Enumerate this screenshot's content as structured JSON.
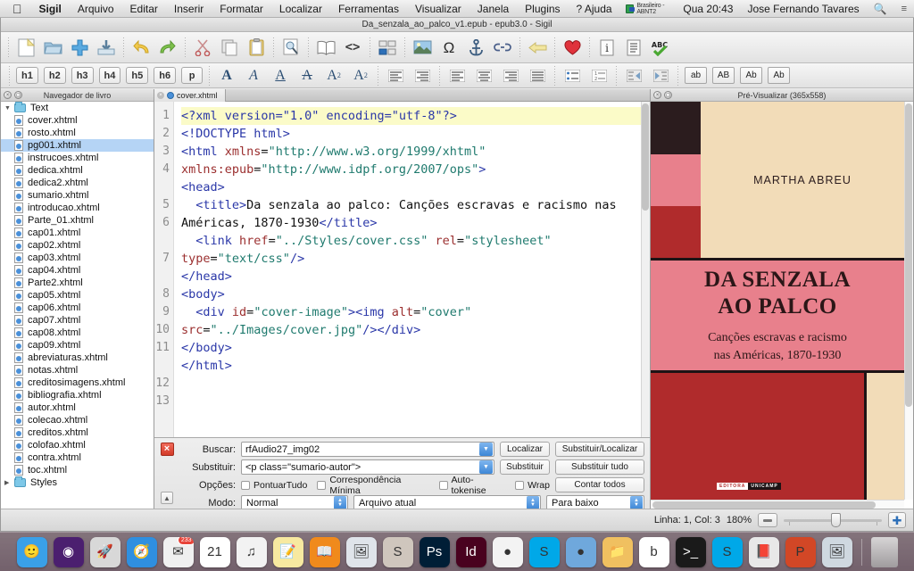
{
  "menubar": {
    "apple_icon": "apple-icon",
    "items": [
      {
        "label": "Sigil",
        "bold": true
      },
      {
        "label": "Arquivo"
      },
      {
        "label": "Editar"
      },
      {
        "label": "Inserir"
      },
      {
        "label": "Formatar"
      },
      {
        "label": "Localizar"
      },
      {
        "label": "Ferramentas"
      },
      {
        "label": "Visualizar"
      },
      {
        "label": "Janela"
      },
      {
        "label": "Plugins"
      },
      {
        "label": "? Ajuda"
      }
    ],
    "input_source": "Brasileiro - ABNT2",
    "clock": "Qua 20:43",
    "user": "Jose Fernando Tavares",
    "search_icon": "search-icon",
    "notification_icon": "notification-center-icon"
  },
  "window": {
    "title": "Da_senzala_ao_palco_v1.epub - epub3.0 - Sigil"
  },
  "toolbar_main": [
    {
      "name": "new-file-button",
      "glyph": "❐"
    },
    {
      "name": "open-folder-button",
      "glyph": "📁"
    },
    {
      "name": "add-file-button",
      "glyph": "✚"
    },
    {
      "name": "save-button",
      "glyph": "💾"
    },
    {
      "name": "undo-button",
      "glyph": "↶"
    },
    {
      "name": "redo-button",
      "glyph": "↷"
    },
    {
      "name": "cut-button",
      "glyph": "✂"
    },
    {
      "name": "copy-button",
      "glyph": "❐"
    },
    {
      "name": "paste-button",
      "glyph": "📋"
    },
    {
      "name": "preview-button",
      "glyph": "🔍"
    },
    {
      "name": "book-view-button",
      "glyph": "📖"
    },
    {
      "name": "code-view-button",
      "glyph": "<>"
    },
    {
      "name": "split-view-button",
      "glyph": "☷"
    },
    {
      "name": "insert-image-button",
      "glyph": "🏞"
    },
    {
      "name": "insert-special-character-button",
      "glyph": "Ω"
    },
    {
      "name": "insert-anchor-button",
      "glyph": "⚓"
    },
    {
      "name": "insert-link-button",
      "glyph": "🔗"
    },
    {
      "name": "back-button",
      "glyph": "←"
    },
    {
      "name": "add-to-favorites-button",
      "glyph": "♥"
    },
    {
      "name": "metadata-editor-button",
      "glyph": "ℹ"
    },
    {
      "name": "toc-editor-button",
      "glyph": "☰"
    },
    {
      "name": "spellcheck-button",
      "glyph": "ABC✔"
    }
  ],
  "toolbar_format": {
    "heading_buttons": [
      "h1",
      "h2",
      "h3",
      "h4",
      "h5",
      "h6",
      "p"
    ],
    "style_buttons": [
      {
        "name": "bold-button",
        "glyph": "A"
      },
      {
        "name": "italic-button",
        "glyph": "A"
      },
      {
        "name": "underline-button",
        "glyph": "A"
      },
      {
        "name": "strikethrough-button",
        "glyph": "A"
      },
      {
        "name": "subscript-button",
        "glyph": "A₂"
      },
      {
        "name": "superscript-button",
        "glyph": "A²"
      }
    ],
    "align_buttons": [
      {
        "name": "align-left-button",
        "glyph": "≡"
      },
      {
        "name": "align-center-button",
        "glyph": "≡"
      },
      {
        "name": "align-right-button",
        "glyph": "≡"
      },
      {
        "name": "align-justify-button",
        "glyph": "≡"
      },
      {
        "name": "bullet-list-button",
        "glyph": "☰"
      },
      {
        "name": "numbered-list-button",
        "glyph": "☰"
      },
      {
        "name": "decrease-indent-button",
        "glyph": "⬅"
      },
      {
        "name": "increase-indent-button",
        "glyph": "➡"
      }
    ],
    "case_buttons": [
      "ab",
      "AB",
      "Ab",
      "Ab"
    ]
  },
  "browser": {
    "title": "Navegador de livro",
    "folders": [
      {
        "label": "Text",
        "expanded": true
      },
      {
        "label": "Styles",
        "expanded": false
      }
    ],
    "files": [
      "cover.xhtml",
      "rosto.xhtml",
      "pg001.xhtml",
      "instrucoes.xhtml",
      "dedica.xhtml",
      "dedica2.xhtml",
      "sumario.xhtml",
      "introducao.xhtml",
      "Parte_01.xhtml",
      "cap01.xhtml",
      "cap02.xhtml",
      "cap03.xhtml",
      "cap04.xhtml",
      "Parte2.xhtml",
      "cap05.xhtml",
      "cap06.xhtml",
      "cap07.xhtml",
      "cap08.xhtml",
      "cap09.xhtml",
      "abreviaturas.xhtml",
      "notas.xhtml",
      "creditosimagens.xhtml",
      "bibliografia.xhtml",
      "autor.xhtml",
      "colecao.xhtml",
      "creditos.xhtml",
      "colofao.xhtml",
      "contra.xhtml",
      "toc.xhtml"
    ],
    "selected_file": "pg001.xhtml"
  },
  "editor": {
    "tab_label": "cover.xhtml",
    "lines": [
      {
        "num": "1",
        "highlight": true,
        "wrapped": false,
        "parts": [
          {
            "t": "pi",
            "v": "<?xml version=\"1.0\" encoding=\"utf-8\"?>"
          }
        ]
      },
      {
        "num": "2",
        "highlight": false,
        "wrapped": false,
        "parts": [
          {
            "t": "tag",
            "v": "<!DOCTYPE html>"
          }
        ]
      },
      {
        "num": "3",
        "highlight": false,
        "wrapped": false,
        "parts": [
          {
            "t": "txt",
            "v": ""
          }
        ]
      },
      {
        "num": "4",
        "highlight": false,
        "wrapped": true,
        "parts": [
          {
            "t": "tag",
            "v": "<html "
          },
          {
            "t": "attr",
            "v": "xmlns"
          },
          {
            "t": "txt",
            "v": "="
          },
          {
            "t": "val",
            "v": "\"http://www.w3.org/1999/xhtml\""
          },
          {
            "t": "txt",
            "v": " "
          },
          {
            "t": "attr",
            "v": "xmlns:epub"
          },
          {
            "t": "txt",
            "v": "="
          },
          {
            "t": "val",
            "v": "\"http://www.idpf.org/2007/ops\""
          },
          {
            "t": "tag",
            "v": ">"
          }
        ]
      },
      {
        "num": "5",
        "highlight": false,
        "wrapped": false,
        "parts": [
          {
            "t": "tag",
            "v": "<head>"
          }
        ]
      },
      {
        "num": "6",
        "highlight": false,
        "wrapped": true,
        "parts": [
          {
            "t": "txt",
            "v": "  "
          },
          {
            "t": "tag",
            "v": "<title>"
          },
          {
            "t": "txt",
            "v": "Da senzala ao palco: Canções escravas e racismo nas Américas, 1870-1930"
          },
          {
            "t": "tag",
            "v": "</title>"
          }
        ]
      },
      {
        "num": "7",
        "highlight": false,
        "wrapped": true,
        "parts": [
          {
            "t": "txt",
            "v": "  "
          },
          {
            "t": "tag",
            "v": "<link "
          },
          {
            "t": "attr",
            "v": "href"
          },
          {
            "t": "txt",
            "v": "="
          },
          {
            "t": "val",
            "v": "\"../Styles/cover.css\""
          },
          {
            "t": "txt",
            "v": " "
          },
          {
            "t": "attr",
            "v": "rel"
          },
          {
            "t": "txt",
            "v": "="
          },
          {
            "t": "val",
            "v": "\"stylesheet\""
          },
          {
            "t": "txt",
            "v": " "
          },
          {
            "t": "attr",
            "v": "type"
          },
          {
            "t": "txt",
            "v": "="
          },
          {
            "t": "val",
            "v": "\"text/css\""
          },
          {
            "t": "tag",
            "v": "/>"
          }
        ]
      },
      {
        "num": "8",
        "highlight": false,
        "wrapped": false,
        "parts": [
          {
            "t": "tag",
            "v": "</head>"
          }
        ]
      },
      {
        "num": "9",
        "highlight": false,
        "wrapped": false,
        "parts": [
          {
            "t": "txt",
            "v": ""
          }
        ]
      },
      {
        "num": "10",
        "highlight": false,
        "wrapped": false,
        "parts": [
          {
            "t": "tag",
            "v": "<body>"
          }
        ]
      },
      {
        "num": "11",
        "highlight": false,
        "wrapped": true,
        "parts": [
          {
            "t": "txt",
            "v": "  "
          },
          {
            "t": "tag",
            "v": "<div "
          },
          {
            "t": "attr",
            "v": "id"
          },
          {
            "t": "txt",
            "v": "="
          },
          {
            "t": "val",
            "v": "\"cover-image\""
          },
          {
            "t": "tag",
            "v": ">"
          },
          {
            "t": "tag",
            "v": "<img "
          },
          {
            "t": "attr",
            "v": "alt"
          },
          {
            "t": "txt",
            "v": "="
          },
          {
            "t": "val",
            "v": "\"cover\""
          },
          {
            "t": "txt",
            "v": " "
          },
          {
            "t": "attr",
            "v": "src"
          },
          {
            "t": "txt",
            "v": "="
          },
          {
            "t": "val",
            "v": "\"../Images/cover.jpg\""
          },
          {
            "t": "tag",
            "v": "/>"
          },
          {
            "t": "tag",
            "v": "</div>"
          }
        ]
      },
      {
        "num": "12",
        "highlight": false,
        "wrapped": false,
        "parts": [
          {
            "t": "tag",
            "v": "</body>"
          }
        ]
      },
      {
        "num": "13",
        "highlight": false,
        "wrapped": false,
        "parts": [
          {
            "t": "tag",
            "v": "</html>"
          }
        ]
      }
    ]
  },
  "find_replace": {
    "find_label": "Buscar:",
    "find_value": "rfAudio27_img02",
    "replace_label": "Substituir:",
    "replace_value": "<p class=\"sumario-autor\">",
    "options_label": "Opções:",
    "options": [
      "PontuarTudo",
      "Correspondência Mínima",
      "Auto-tokenise",
      "Wrap"
    ],
    "mode_label": "Modo:",
    "mode_value": "Normal",
    "scope_value": "Arquivo atual",
    "direction_value": "Para baixo",
    "buttons": {
      "find": "Localizar",
      "replace_find": "Substituir/Localizar",
      "replace": "Substituir",
      "replace_all": "Substituir tudo",
      "count_all": "Contar todos"
    }
  },
  "preview": {
    "title": "Pré-Visualizar (365x558)",
    "cover": {
      "author": "MARTHA ABREU",
      "title_line1": "DA SENZALA",
      "title_line2": "AO PALCO",
      "subtitle_line1": "Canções escravas e racismo",
      "subtitle_line2": "nas Américas, 1870-1930",
      "publisher_white": "EDITORA",
      "publisher_black": "UNICAMP",
      "colors": {
        "cream": "#f2dcb8",
        "pink": "#e8808c",
        "red": "#b02b2c",
        "dark": "#2b1c1e"
      }
    }
  },
  "statusbar": {
    "position": "Linha: 1, Col: 3",
    "zoom": "180%",
    "reset_zoom_icon": "minus-icon",
    "zoom_in_icon": "plus-icon"
  },
  "dock": {
    "items": [
      {
        "name": "finder",
        "glyph": "🙂",
        "bg": "#3aa0e8",
        "running": true
      },
      {
        "name": "siri",
        "glyph": "◉",
        "bg": "#4b1f6f",
        "running": false
      },
      {
        "name": "launchpad",
        "glyph": "🚀",
        "bg": "#d8d8d8",
        "running": false
      },
      {
        "name": "safari",
        "glyph": "🧭",
        "bg": "#2f8fe0",
        "running": false
      },
      {
        "name": "mail",
        "glyph": "✉",
        "bg": "#f0f0f0",
        "running": true,
        "badge": "233"
      },
      {
        "name": "calendar",
        "glyph": "21",
        "bg": "#ffffff",
        "running": false
      },
      {
        "name": "itunes",
        "glyph": "♫",
        "bg": "#f2f2f2",
        "running": false
      },
      {
        "name": "notes",
        "glyph": "📝",
        "bg": "#f7e9a0",
        "running": false
      },
      {
        "name": "ibooks",
        "glyph": "📖",
        "bg": "#f08a1c",
        "running": false
      },
      {
        "name": "keynote",
        "glyph": "🖼",
        "bg": "#dfe4ea",
        "running": false
      },
      {
        "name": "sigil",
        "glyph": "S",
        "bg": "#cfc6bd",
        "running": true
      },
      {
        "name": "photoshop",
        "glyph": "Ps",
        "bg": "#001e36",
        "running": false
      },
      {
        "name": "indesign",
        "glyph": "Id",
        "bg": "#49021f",
        "running": false
      },
      {
        "name": "chrome",
        "glyph": "●",
        "bg": "#f3f3f3",
        "running": false
      },
      {
        "name": "skype",
        "glyph": "S",
        "bg": "#00a8e8",
        "running": false
      },
      {
        "name": "colorwheel",
        "glyph": "●",
        "bg": "#6fa8dc",
        "running": false
      },
      {
        "name": "folder",
        "glyph": "📁",
        "bg": "#f0c060",
        "running": false
      },
      {
        "name": "browser-b",
        "glyph": "b",
        "bg": "#ffffff",
        "running": false
      },
      {
        "name": "terminal",
        "glyph": ">_",
        "bg": "#1a1a1a",
        "running": false
      },
      {
        "name": "skype2",
        "glyph": "S",
        "bg": "#00a8e8",
        "running": false
      },
      {
        "name": "acrobat",
        "glyph": "📕",
        "bg": "#e8e8e8",
        "running": false
      },
      {
        "name": "powerpoint",
        "glyph": "P",
        "bg": "#d24726",
        "running": false
      },
      {
        "name": "preview-app",
        "glyph": "🖼",
        "bg": "#cfd8e0",
        "running": false
      }
    ]
  }
}
